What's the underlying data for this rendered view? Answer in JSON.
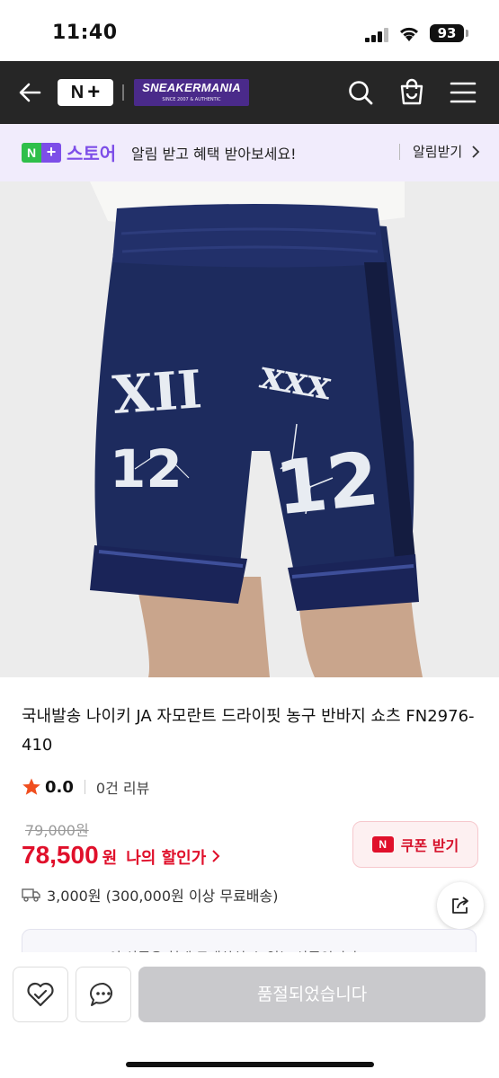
{
  "status_bar": {
    "time": "11:40",
    "battery": "93"
  },
  "header": {
    "back_icon": "arrow-left-icon",
    "logo_text": {
      "n": "N",
      "plus": "+"
    },
    "brand_name": "SNEAKERMANIA",
    "brand_sub": "SINCE 2007 & AUTHENTIC",
    "icons": [
      "search-icon",
      "shopping-bag-icon",
      "hamburger-menu-icon"
    ]
  },
  "store_banner": {
    "badge_n": "N",
    "badge_plus": "+",
    "label": "스토어",
    "message": "알림 받고 혜택 받아보세요!",
    "action": "알림받기"
  },
  "product": {
    "image_alt": "navy basketball shorts",
    "title": "국내발송 나이키 JA 자모란트 드라이핏 농구 반바지 쇼츠 FN2976-410",
    "rating": "0.0",
    "reviews": "0건 리뷰",
    "original_price": "79,000원",
    "price": "78,500",
    "price_unit": "원",
    "my_discount": "나의 할인가",
    "coupon_badge": "N",
    "coupon_label": "쿠폰 받기",
    "delivery": "3,000원 (300,000원 이상 무료배송)",
    "notice": "이 상품은 현재 구매하실 수 없는 상품입니다."
  },
  "bottom_bar": {
    "soldout_label": "품절되었습니다"
  },
  "colors": {
    "header_bg": "#262626",
    "store_bg": "#f1ecfc",
    "accent_purple": "#7d4ee8",
    "price_red": "#e0102b",
    "naver_green": "#2fbf4a"
  }
}
